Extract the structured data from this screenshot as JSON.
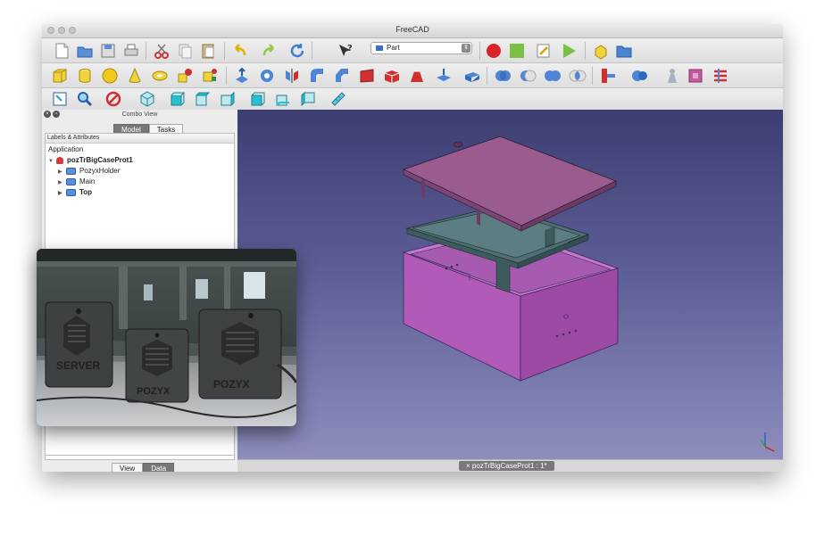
{
  "window": {
    "title": "FreeCAD"
  },
  "toolbar": {
    "workbench_selector": "Part"
  },
  "combo_view": {
    "title": "Combo View",
    "tabs": [
      {
        "label": "Model",
        "active": true
      },
      {
        "label": "Tasks",
        "active": false
      }
    ],
    "tree_header": "Labels & Attributes",
    "tree": {
      "root": "Application",
      "document": "pozTrBigCaseProt1",
      "items": [
        {
          "label": "PozyxHolder"
        },
        {
          "label": "Main"
        },
        {
          "label": "Top"
        }
      ]
    },
    "bottom_tabs": [
      {
        "label": "View",
        "active": false
      },
      {
        "label": "Data",
        "active": true
      }
    ]
  },
  "viewport": {
    "document_tab": "pozTrBigCaseProt1 : 1*",
    "model_colors": {
      "lid": "#9a5c8e",
      "holder": "#4f6f73",
      "base": "#b25ab8"
    }
  },
  "photo": {
    "case_labels": [
      "SERVER",
      "POZYX",
      "POZYX"
    ]
  }
}
